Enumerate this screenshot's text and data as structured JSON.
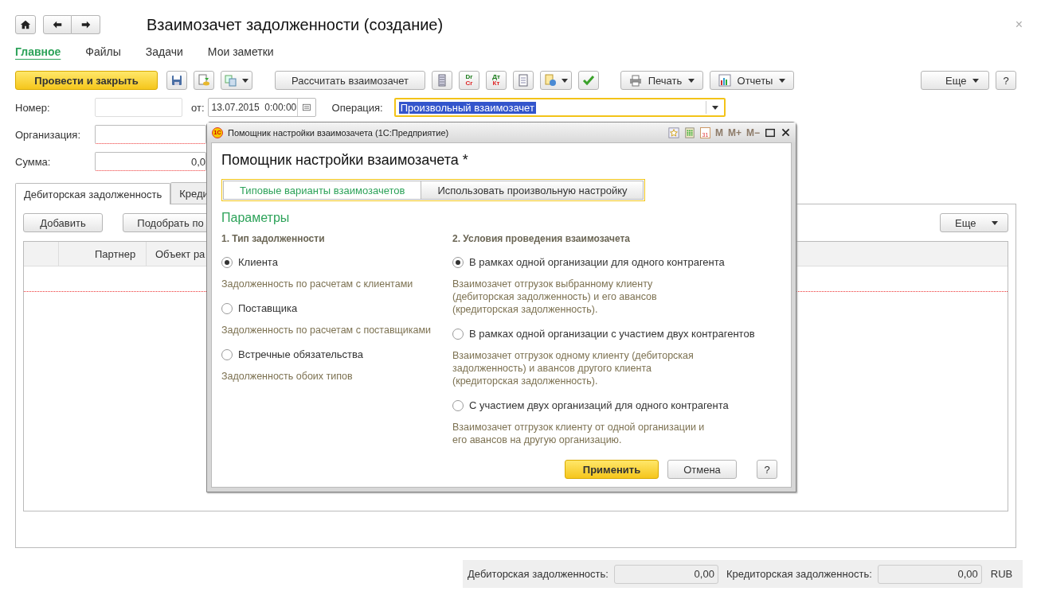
{
  "header": {
    "title": "Взаимозачет задолженности (создание)",
    "close": "×"
  },
  "nav": [
    {
      "label": "Главное",
      "selected": true
    },
    {
      "label": "Файлы",
      "selected": false
    },
    {
      "label": "Задачи",
      "selected": false
    },
    {
      "label": "Мои заметки",
      "selected": false
    }
  ],
  "toolbar": {
    "post_button": "Провести и закрыть",
    "calc_button": "Рассчитать взаимозачет",
    "dr_cr": {
      "top": "Dr",
      "bottom": "Cr"
    },
    "dt_kt": {
      "top": "Дт",
      "bottom": "Кт"
    },
    "print_button": "Печать",
    "reports_button": "Отчеты",
    "more_button": "Еще",
    "help_button": "?"
  },
  "fields": {
    "number_label": "Номер:",
    "date_label": "от:",
    "date_value": "13.07.2015  0:00:00",
    "operation_label": "Операция:",
    "operation_value": "Произвольный взаимозачет",
    "organization_label": "Организация:",
    "sum_label": "Сумма:",
    "sum_value": "0,0"
  },
  "tabs": [
    {
      "label": "Дебиторская задолженность",
      "selected": true
    },
    {
      "label": "Креди",
      "selected": false
    }
  ],
  "tab_toolbar": {
    "add_button": "Добавить",
    "pick_button": "Подобрать по",
    "more_button": "Еще"
  },
  "table": {
    "columns": [
      "Партнер",
      "Объект ра"
    ]
  },
  "footer": {
    "debit_label": "Дебиторская задолженность:",
    "debit_value": "0,00",
    "credit_label": "Кредиторская задолженность:",
    "credit_value": "0,00",
    "currency": "RUB"
  },
  "dialog": {
    "window_title": "Помощник настройки взаимозачета  (1С:Предприятие)",
    "logo": "1С",
    "calendar_day": "31",
    "memory": [
      {
        "label": "M",
        "disabled": true
      },
      {
        "label": "M+",
        "disabled": true
      },
      {
        "label": "M−",
        "disabled": true
      }
    ],
    "heading": "Помощник настройки взаимозачета *",
    "modes": [
      {
        "label": "Типовые варианты взаимозачетов",
        "selected": true
      },
      {
        "label": "Использовать произвольную настройку",
        "selected": false
      }
    ],
    "section_title": "Параметры",
    "groups": [
      {
        "title": "1. Тип задолженности",
        "options": [
          {
            "label": "Клиента",
            "selected": true,
            "description": "Задолженность по расчетам с клиентами"
          },
          {
            "label": "Поставщика",
            "selected": false,
            "description": "Задолженность по расчетам с поставщиками"
          },
          {
            "label": "Встречные обязательства",
            "selected": false,
            "description": "Задолженность обоих типов"
          }
        ]
      },
      {
        "title": "2. Условия проведения взаимозачета",
        "options": [
          {
            "label": "В рамках одной организации для одного контрагента",
            "selected": true,
            "description": "Взаимозачет отгрузок выбранному клиенту (дебиторская задолженность) и его авансов (кредиторская задолженность)."
          },
          {
            "label": "В рамках одной организации с участием двух контрагентов",
            "selected": false,
            "description": "Взаимозачет отгрузок одному клиенту (дебиторская задолженность) и авансов другого клиента (кредиторская задолженность)."
          },
          {
            "label": "С участием двух организаций для одного контрагента",
            "selected": false,
            "description": "Взаимозачет отгрузок клиенту от одной организации и его авансов на другую организацию."
          }
        ]
      }
    ],
    "apply_button": "Применить",
    "cancel_button": "Отмена",
    "help_button": "?"
  }
}
